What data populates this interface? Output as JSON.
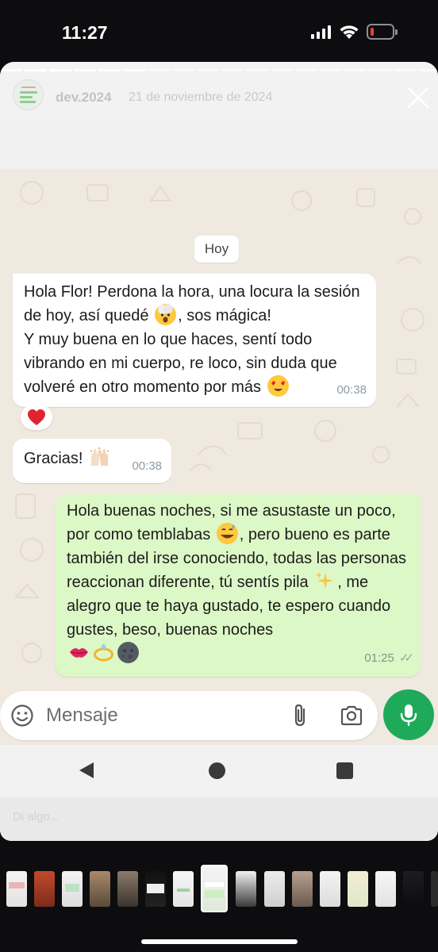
{
  "status_bar": {
    "time": "11:27"
  },
  "story": {
    "username": "dev.2024",
    "date": "21 de noviembre de 2024"
  },
  "chat": {
    "day_label": "Hoy",
    "messages": [
      {
        "direction": "incoming",
        "text": "Hola Flor! Perdona la hora, una locura la sesión de hoy, así quedé",
        "text2": ", sos mágica!",
        "text3": "Y muy buena en lo que haces, sentí todo vibrando en mi cuerpo, re loco, sin duda que volveré en otro momento por más",
        "time": "00:38",
        "reaction": "red-heart"
      },
      {
        "direction": "incoming",
        "text": "Gracias!",
        "time": "00:38"
      },
      {
        "direction": "outgoing",
        "text": "Hola buenas noches, si me asustaste un poco, por como temblabas",
        "text2": ", pero bueno es parte también del irse conociendo, todas las personas reaccionan diferente, tú sentís pila",
        "text3": ", me alegro que te haya gustado, te espero cuando gustes, beso, buenas noches",
        "time": "01:25",
        "status": "read"
      }
    ]
  },
  "input": {
    "placeholder": "Mensaje"
  },
  "reply_bar": {
    "placeholder": "Di algo..."
  },
  "colors": {
    "accent": "#1faa59",
    "outgoing_bubble": "#dcf8c6",
    "incoming_bubble": "#ffffff",
    "chat_bg": "#efe9e0"
  }
}
